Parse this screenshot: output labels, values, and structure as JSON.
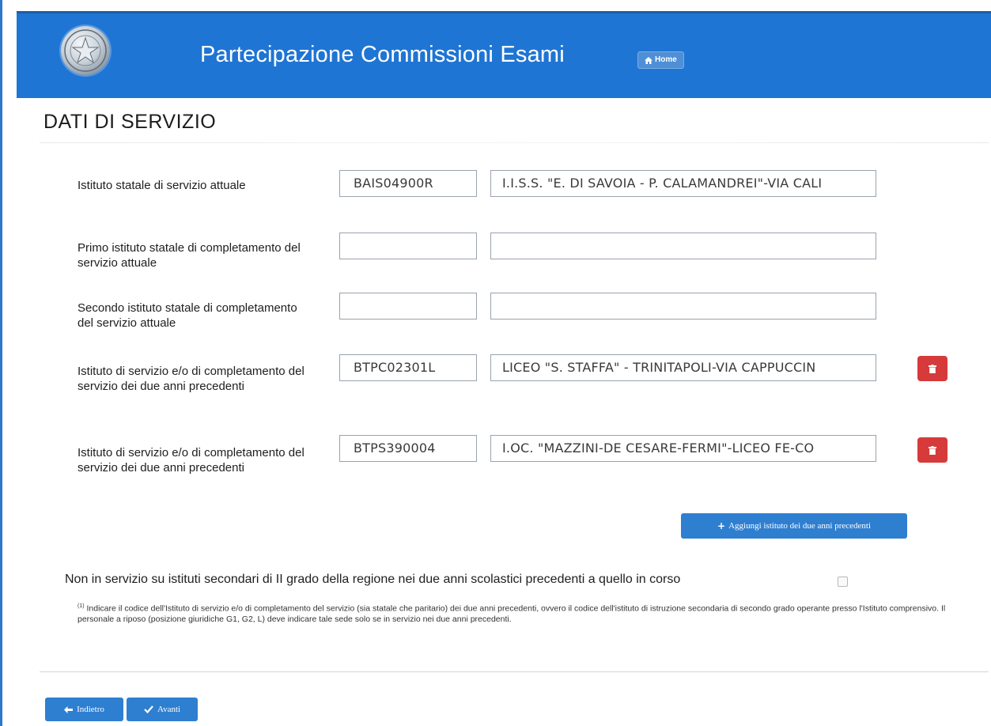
{
  "header": {
    "title": "Partecipazione Commissioni Esami",
    "home_label": "Home"
  },
  "section": {
    "title": "DATI DI SERVIZIO"
  },
  "rows": [
    {
      "label": "Istituto statale di servizio attuale",
      "code": "BAIS04900R",
      "description": "I.I.S.S. \"E. DI SAVOIA - P. CALAMANDREI\"-VIA CALI"
    },
    {
      "label": "Primo istituto statale di completamento del servizio attuale",
      "code": "",
      "description": ""
    },
    {
      "label": "Secondo istituto statale di completamento del servizio attuale",
      "code": "",
      "description": ""
    },
    {
      "label": "Istituto di servizio e/o di completamento del servizio dei due anni precedenti",
      "code": "BTPC02301L",
      "description": "LICEO \"S. STAFFA\" - TRINITAPOLI-VIA CAPPUCCIN"
    },
    {
      "label": "Istituto di servizio e/o di completamento del servizio dei due anni precedenti",
      "code": "BTPS390004",
      "description": "I.OC. \"MAZZINI-DE CESARE-FERMI\"-LICEO FE-CO"
    }
  ],
  "add_button_label": "Aggiungi istituto dei due anni precedenti",
  "not_in_service_label": "Non in servizio su istituti secondari di II grado della regione nei due anni scolastici precedenti a quello in corso",
  "footnote": {
    "marker": "(1)",
    "text": "Indicare il codice dell'Istituto di servizio e/o di completamento del servizio (sia statale che paritario) dei due anni precedenti, ovvero il codice dell'istituto di istruzione secondaria di secondo grado operante presso l'Istituto comprensivo. Il personale a riposo (posizione giuridiche G1, G2, L) deve indicare tale sede solo se in servizio nei due anni precedenti."
  },
  "nav": {
    "back_label": "Indietro",
    "next_label": "Avanti"
  },
  "colors": {
    "header_bg": "#1f75d3",
    "primary_button": "#2f7fd0",
    "delete_button": "#d63a3a"
  }
}
